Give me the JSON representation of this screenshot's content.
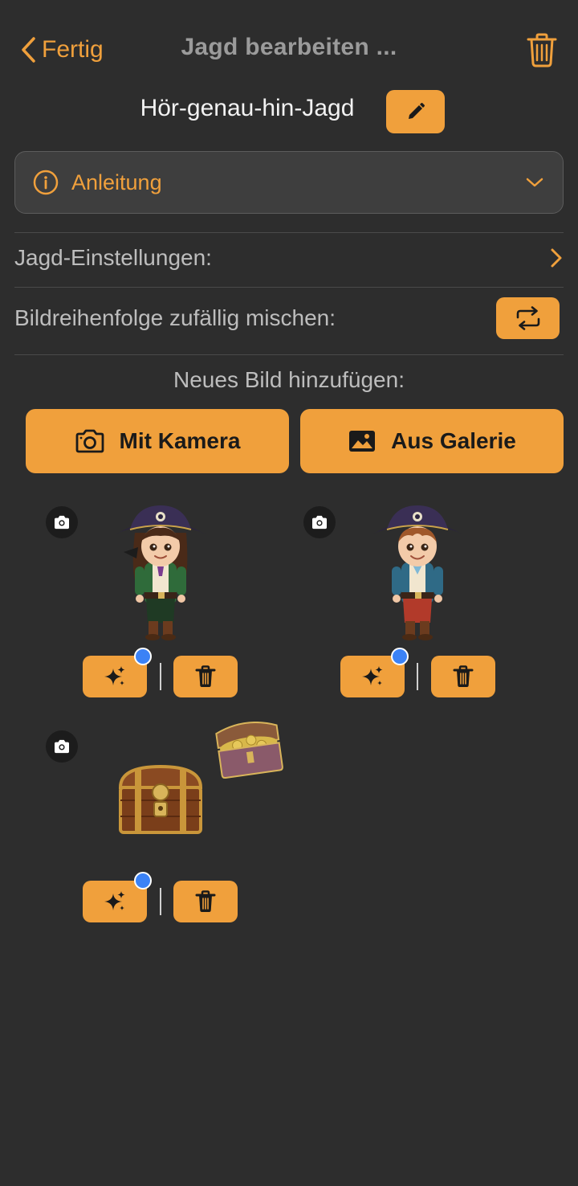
{
  "header": {
    "back_label": "Fertig",
    "title": "Jagd bearbeiten ...",
    "hunt_name": "Hör-genau-hin-Jagd"
  },
  "instructions": {
    "label": "Anleitung"
  },
  "settings": {
    "hunt_settings_label": "Jagd-Einstellungen:",
    "shuffle_label": "Bildreihenfolge zufällig mischen:"
  },
  "add_image": {
    "label": "Neues Bild hinzufügen:",
    "camera_label": "Mit Kamera",
    "gallery_label": "Aus Galerie"
  },
  "images": [
    {
      "subject": "pirate-girl"
    },
    {
      "subject": "pirate-boy"
    },
    {
      "subject": "treasure-chests"
    }
  ],
  "colors": {
    "accent": "#f0a03c",
    "background": "#2d2d2d",
    "badge_dot": "#3b82f6"
  }
}
